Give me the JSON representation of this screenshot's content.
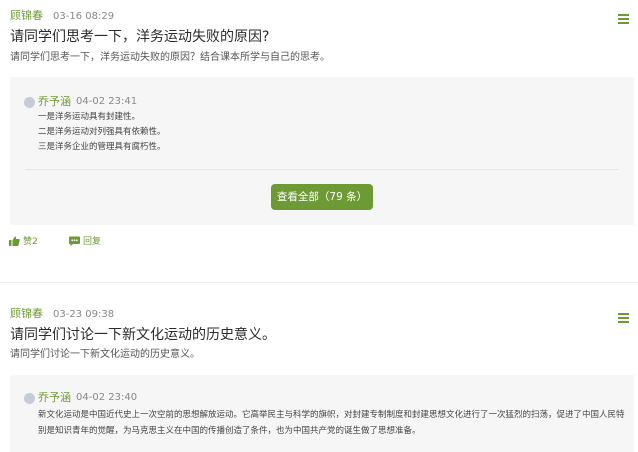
{
  "posts": [
    {
      "author": "顾锦春",
      "time": "03-16 08:29",
      "title": "请同学们思考一下，洋务运动失败的原因?",
      "description": "请同学们思考一下，洋务运动失败的原因？结合课本所学与自己的思考。",
      "reply": {
        "author": "乔予涵",
        "time": "04-02 23:41",
        "lines": [
          "一是洋务运动具有封建性。",
          "二是洋务运动对列强具有依赖性。",
          "三是洋务企业的管理具有腐朽性。"
        ]
      },
      "view_all_label": "查看全部（79 条）",
      "like_label": "赞2",
      "reply_label": "回复"
    },
    {
      "author": "顾锦春",
      "time": "03-23 09:38",
      "title": "请同学们讨论一下新文化运动的历史意义。",
      "description": "请同学们讨论一下新文化运动的历史意义。",
      "reply": {
        "author": "乔予涵",
        "time": "04-02 23:40",
        "text": "新文化运动是中国近代史上一次空前的思想解放运动。它高举民主与科学的旗帜，对封建专制制度和封建思想文化进行了一次猛烈的扫荡，促进了中国人民特别是知识青年的觉醒，为马克思主义在中国的传播创造了条件，也为中国共产党的诞生做了思想准备。"
      }
    }
  ],
  "icons": {
    "menu": "hamburger-menu-icon",
    "like": "thumbs-up-icon",
    "reply": "comment-icon"
  },
  "colors": {
    "accent": "#6d9a35",
    "reply_bg": "#f6f6f6"
  }
}
